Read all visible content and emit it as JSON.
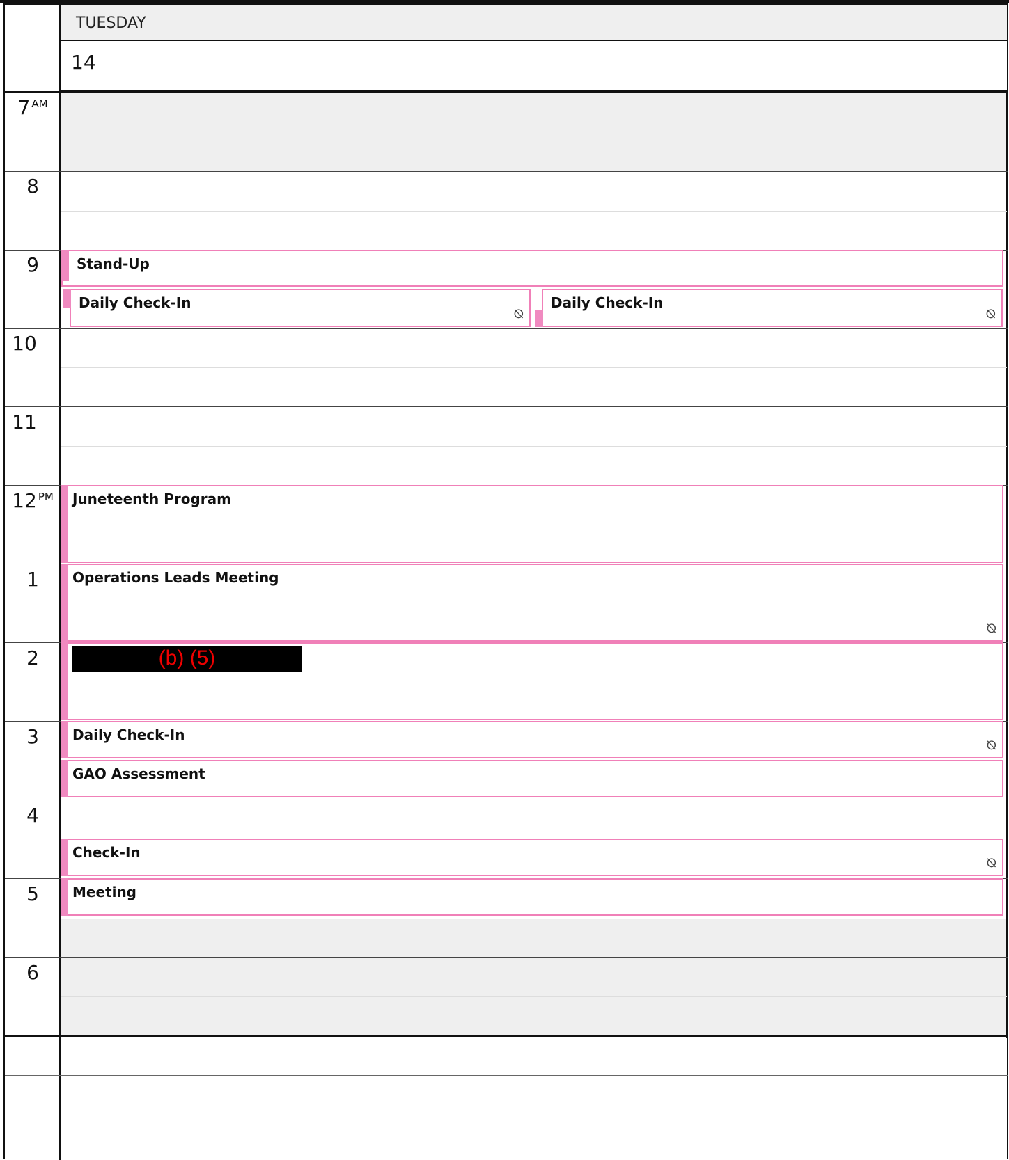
{
  "day": {
    "name": "TUESDAY",
    "number": "14"
  },
  "hours": [
    {
      "h": "7",
      "suffix": "AM"
    },
    {
      "h": "8",
      "suffix": ""
    },
    {
      "h": "9",
      "suffix": ""
    },
    {
      "h": "10",
      "suffix": ""
    },
    {
      "h": "11",
      "suffix": ""
    },
    {
      "h": "12",
      "suffix": "PM"
    },
    {
      "h": "1",
      "suffix": ""
    },
    {
      "h": "2",
      "suffix": ""
    },
    {
      "h": "3",
      "suffix": ""
    },
    {
      "h": "4",
      "suffix": ""
    },
    {
      "h": "5",
      "suffix": ""
    },
    {
      "h": "6",
      "suffix": ""
    }
  ],
  "events": {
    "standup": "Stand-Up",
    "checkin_a": "Daily Check-In",
    "checkin_b": "Daily Check-In",
    "juneteenth": "Juneteenth Program",
    "ops": "Operations Leads Meeting",
    "redacted": "(b) (5)",
    "checkin_3": "Daily Check-In",
    "gao": "GAO Assessment",
    "checkin_4": "Check-In",
    "meeting": "Meeting"
  },
  "icons": {
    "sync_off": "sync-off-icon"
  },
  "colors": {
    "event_accent": "#f08ac0",
    "event_border": "#f080b8",
    "off_hours": "#efefef"
  }
}
